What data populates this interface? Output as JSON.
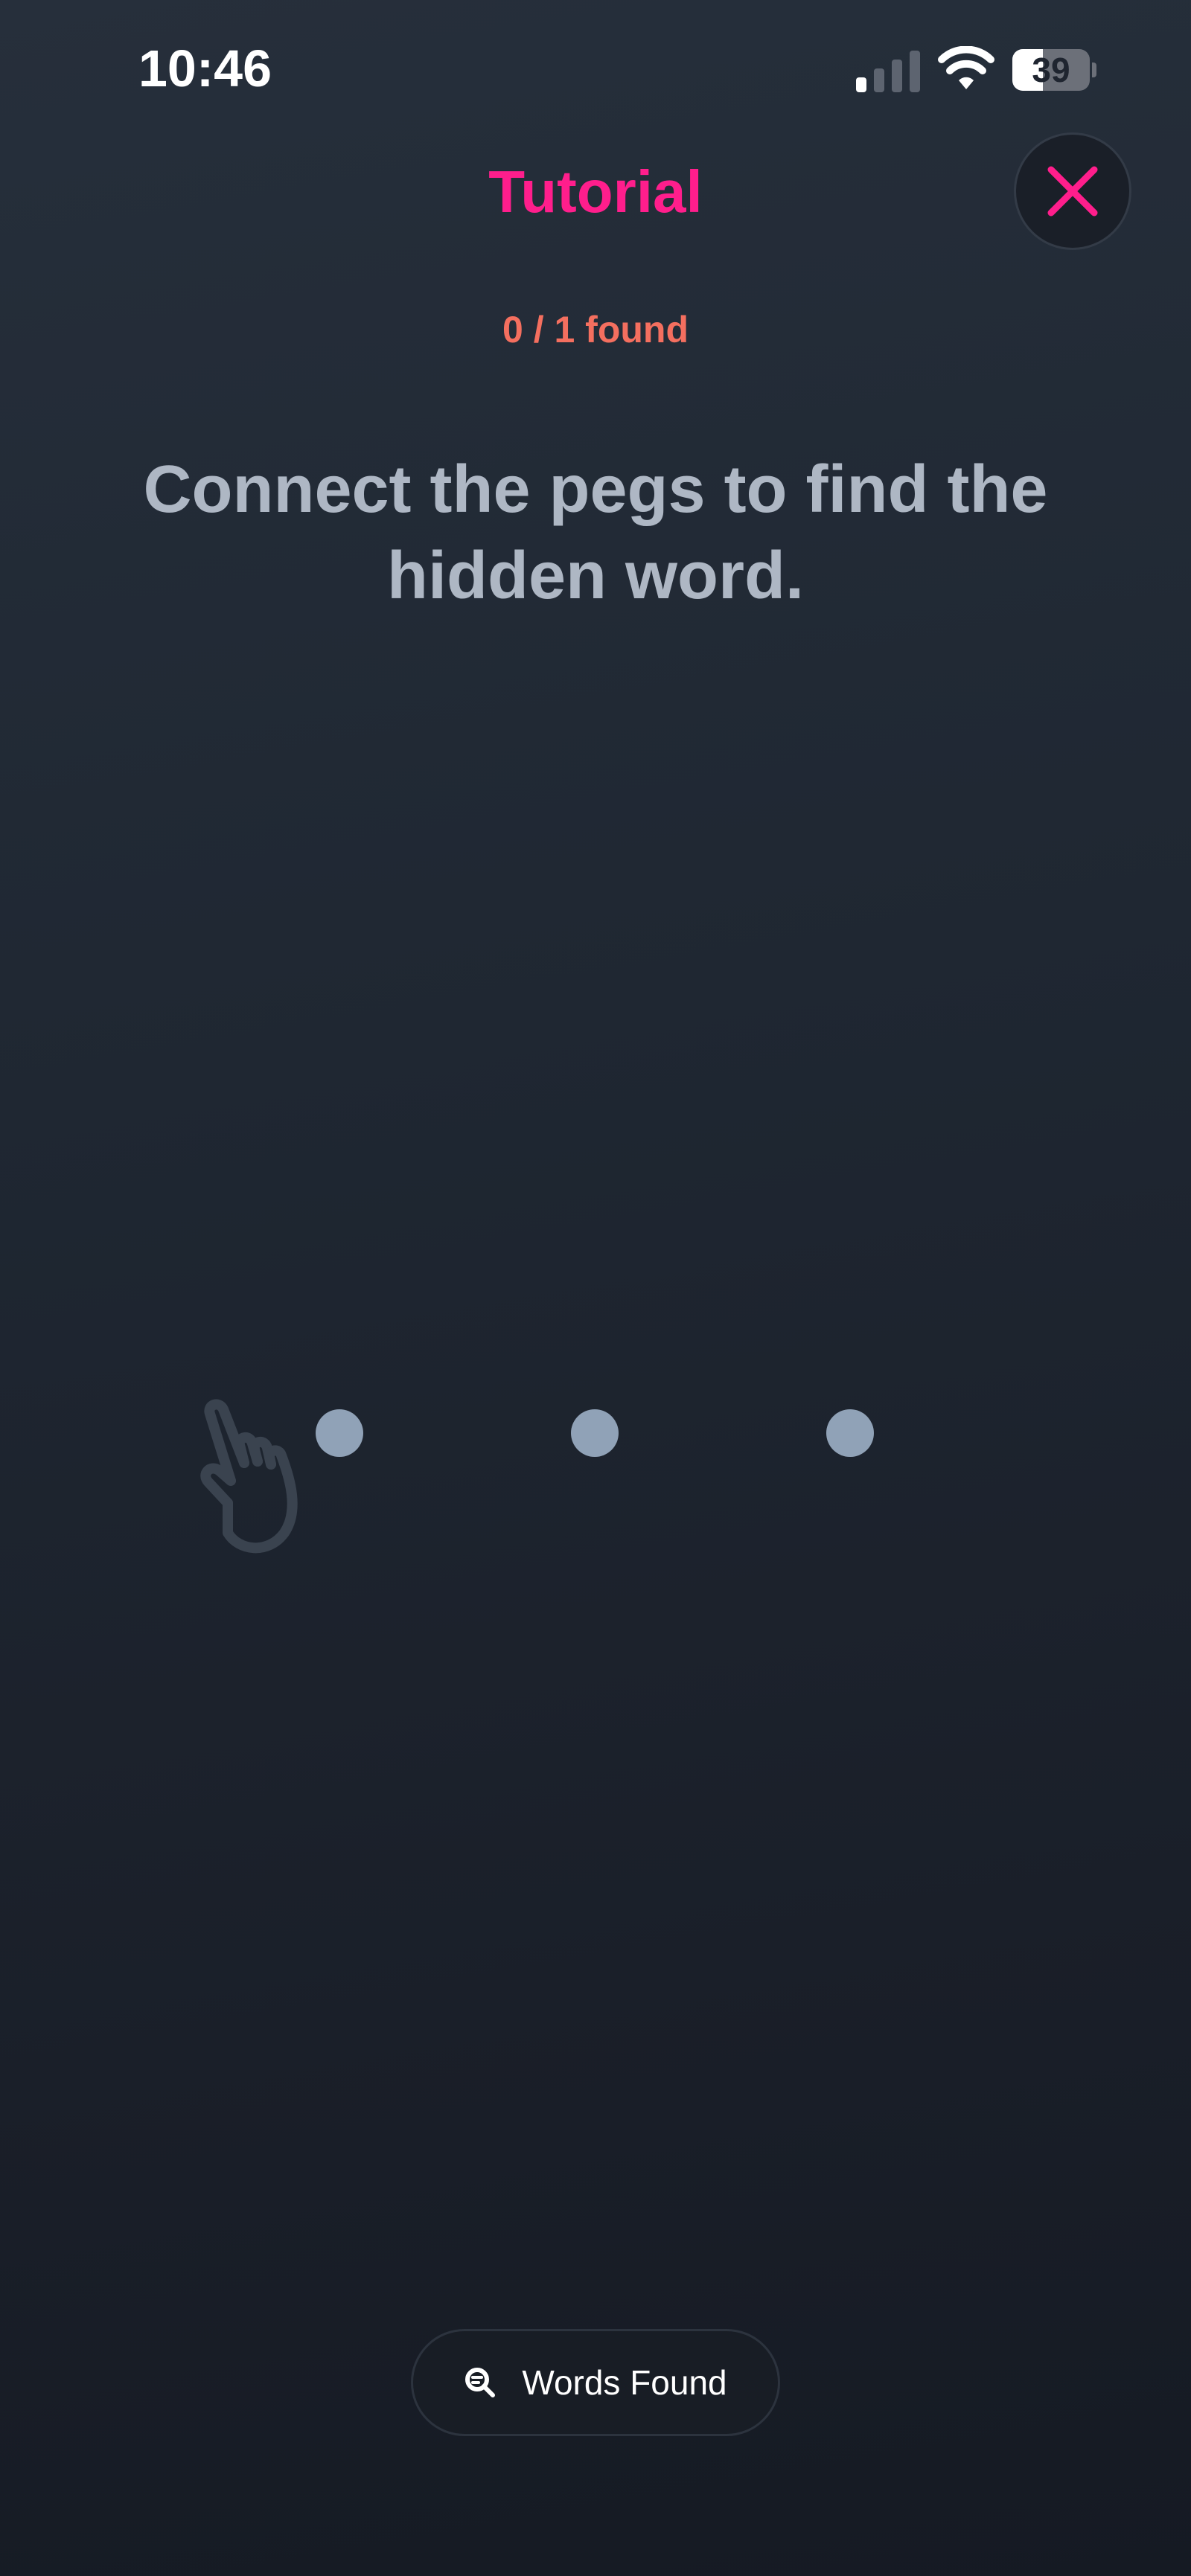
{
  "status_bar": {
    "time": "10:46",
    "battery_level": "39"
  },
  "header": {
    "title": "Tutorial",
    "close_icon": "close-x-icon"
  },
  "progress": {
    "text": "0 / 1 found"
  },
  "instruction": {
    "text": "Connect the pegs to find the hidden word."
  },
  "board": {
    "peg_count": 3,
    "hint_icon": "pointing-hand-icon"
  },
  "footer": {
    "words_found_label": "Words Found",
    "icon": "search-icon"
  },
  "colors": {
    "accent": "#ff1e8c",
    "progress": "#f46f5f",
    "instruction": "#aeb7c4",
    "peg": "#90a2b7"
  }
}
